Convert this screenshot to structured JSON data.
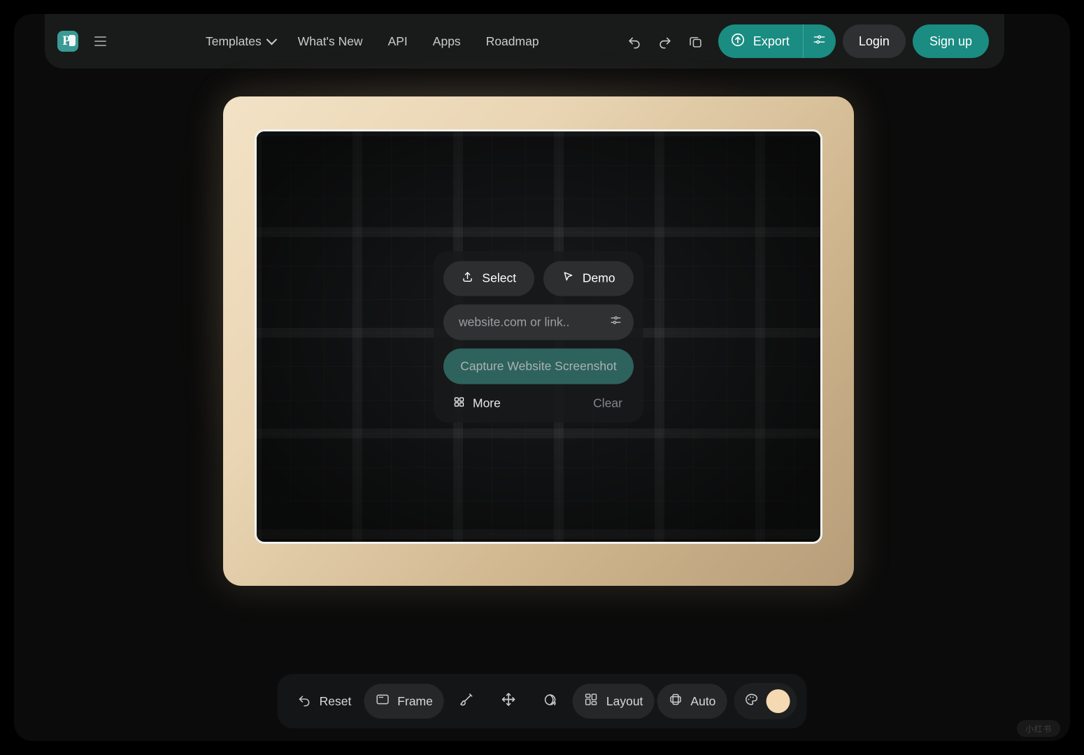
{
  "app": {
    "logo_text": "P",
    "background": "#000000",
    "accent": "#1a8c82",
    "frame_color": "#e9d5b3",
    "swatch_color": "#f4d9b2"
  },
  "navbar": {
    "menu_icon": "hamburger-icon",
    "links": [
      {
        "label": "Templates",
        "has_chevron": true
      },
      {
        "label": "What's New",
        "has_chevron": false
      },
      {
        "label": "API",
        "has_chevron": false
      },
      {
        "label": "Apps",
        "has_chevron": false
      },
      {
        "label": "Roadmap",
        "has_chevron": false
      }
    ],
    "history": {
      "undo_icon": "undo-icon",
      "redo_icon": "redo-icon",
      "copy_icon": "copy-icon"
    },
    "export": {
      "label": "Export",
      "icon": "upload-circle-icon",
      "settings_icon": "sliders-icon"
    },
    "login_label": "Login",
    "signup_label": "Sign up"
  },
  "control_card": {
    "select_button": {
      "label": "Select",
      "icon": "upload-icon"
    },
    "demo_button": {
      "label": "Demo",
      "icon": "cursor-icon"
    },
    "url_input": {
      "placeholder": "website.com or link..",
      "value": "",
      "settings_icon": "sliders-icon"
    },
    "capture_button": {
      "label": "Capture Website Screenshot"
    },
    "more_button": {
      "label": "More",
      "icon": "grid-icon"
    },
    "clear_button": {
      "label": "Clear"
    }
  },
  "toolbar": {
    "items": [
      {
        "name": "reset",
        "label": "Reset",
        "icon": "undo-icon",
        "active": false,
        "icon_only": false
      },
      {
        "name": "frame",
        "label": "Frame",
        "icon": "frame-icon",
        "active": true,
        "icon_only": false
      },
      {
        "name": "brush",
        "label": "",
        "icon": "brush-icon",
        "active": false,
        "icon_only": true
      },
      {
        "name": "move",
        "label": "",
        "icon": "move-icon",
        "active": false,
        "icon_only": true
      },
      {
        "name": "rotate",
        "label": "",
        "icon": "rotate-3d-icon",
        "active": false,
        "icon_only": true
      },
      {
        "name": "layout",
        "label": "Layout",
        "icon": "grid-icon",
        "active": true,
        "icon_only": false
      },
      {
        "name": "auto",
        "label": "Auto",
        "icon": "layers-icon",
        "active": true,
        "icon_only": false
      }
    ],
    "color_picker": {
      "icon": "palette-icon",
      "swatch": "#f4d9b2"
    }
  },
  "watermark": {
    "text": "小红书"
  }
}
